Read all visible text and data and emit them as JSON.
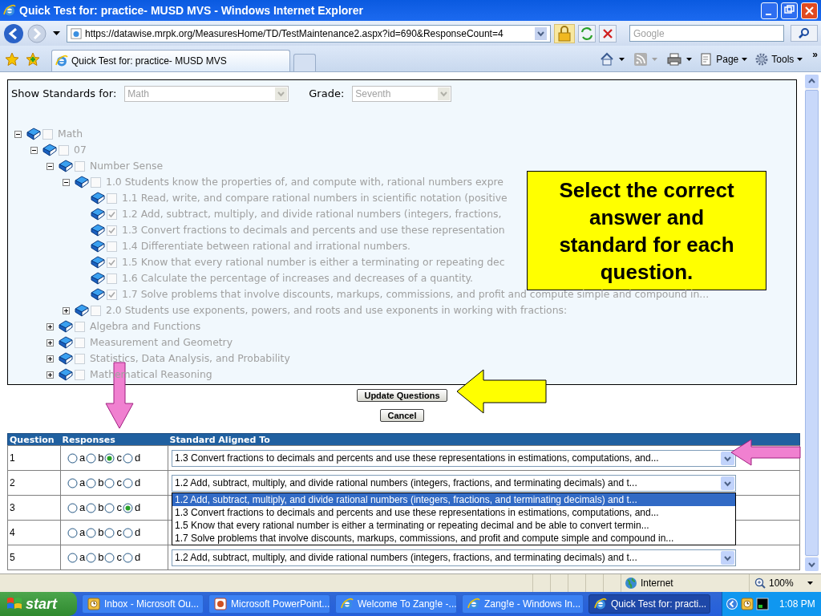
{
  "window": {
    "title": "Quick Test for: practice- MUSD MVS - Windows Internet Explorer"
  },
  "address_bar": {
    "url": "https://datawise.mrpk.org/MeasuresHome/TD/TestMaintenance2.aspx?id=690&ResponseCount=4",
    "search_placeholder": "Google"
  },
  "tabs": [
    {
      "label": "Quick Test for: practice- MUSD MVS",
      "selected": true
    }
  ],
  "command_bar": [
    "Page",
    "Tools",
    "»"
  ],
  "filters": [
    {
      "label": "Show Standards for:",
      "value": "Math"
    },
    {
      "label": "Grade:",
      "value": "Seventh"
    }
  ],
  "tree": [
    {
      "label": "Math",
      "checked": false,
      "expanded": true,
      "children": [
        {
          "label": "07",
          "checked": false,
          "expanded": true,
          "children": [
            {
              "label": "Number Sense",
              "checked": false,
              "expanded": true,
              "children": [
                {
                  "label": "1.0 Students know the properties of, and compute with, rational numbers expre",
                  "checked": false,
                  "expanded": true,
                  "children": [
                    {
                      "label": "1.1 Read, write, and compare rational numbers in scientific notation (positive",
                      "checked": false
                    },
                    {
                      "label": "1.2 Add, subtract, multiply, and divide rational numbers (integers, fractions,",
                      "checked": true
                    },
                    {
                      "label": "1.3 Convert fractions to decimals and percents and use these representation",
                      "checked": true
                    },
                    {
                      "label": "1.4 Differentiate between rational and irrational numbers.",
                      "checked": false
                    },
                    {
                      "label": "1.5 Know that every rational number is either a terminating or repeating dec",
                      "checked": true
                    },
                    {
                      "label": "1.6 Calculate the percentage of increases and decreases of a quantity.",
                      "checked": false
                    },
                    {
                      "label": "1.7 Solve problems that involve discounts, markups, commissions, and profit and compute simple and compound in...",
                      "checked": true
                    }
                  ]
                },
                {
                  "label": "2.0 Students use exponents, powers, and roots and use exponents in working with fractions:",
                  "checked": false,
                  "expanded": false
                }
              ]
            },
            {
              "label": "Algebra and Functions",
              "checked": false,
              "expanded": false
            },
            {
              "label": "Measurement and Geometry",
              "checked": false,
              "expanded": false
            },
            {
              "label": "Statistics, Data Analysis, and Probability",
              "checked": false,
              "expanded": false
            },
            {
              "label": "Mathematical Reasoning",
              "checked": false,
              "expanded": false
            }
          ]
        }
      ]
    }
  ],
  "buttons": [
    "Update Questions",
    "Cancel"
  ],
  "callout": "Select the correct answer and standard for each question.",
  "table": {
    "columns": [
      "Question",
      "Responses",
      "Standard Aligned To"
    ],
    "rows": [
      {
        "question": "1",
        "responses": [
          {
            "label": "a",
            "selected": false
          },
          {
            "label": "b",
            "selected": false
          },
          {
            "label": "c",
            "selected": true
          },
          {
            "label": "d",
            "selected": false
          }
        ],
        "standard": "1.3 Convert fractions to decimals and percents and use these representations in estimations, computations, and..."
      },
      {
        "question": "2",
        "responses": [
          {
            "label": "a",
            "selected": false
          },
          {
            "label": "b",
            "selected": false
          },
          {
            "label": "c",
            "selected": false
          },
          {
            "label": "d",
            "selected": false
          }
        ],
        "standard": "1.2 Add, subtract, multiply, and divide rational numbers (integers, fractions, and terminating decimals) and t...",
        "options": [
          {
            "label": "1.2 Add, subtract, multiply, and divide rational numbers (integers, fractions, and terminating decimals) and t...",
            "selected": true
          },
          {
            "label": "1.3 Convert fractions to decimals and percents and use these representations in estimations, computations, and...",
            "selected": false
          },
          {
            "label": "1.5 Know that every rational number is either a terminating or repeating decimal and be able to convert termin...",
            "selected": false
          },
          {
            "label": "1.7 Solve problems that involve discounts, markups, commissions, and profit and compute simple and compound in...",
            "selected": false
          }
        ]
      },
      {
        "question": "3",
        "responses": [
          {
            "label": "a",
            "selected": false
          },
          {
            "label": "b",
            "selected": false
          },
          {
            "label": "c",
            "selected": false
          },
          {
            "label": "d",
            "selected": true
          }
        ]
      },
      {
        "question": "4",
        "responses": [
          {
            "label": "a",
            "selected": false
          },
          {
            "label": "b",
            "selected": false
          },
          {
            "label": "c",
            "selected": false
          },
          {
            "label": "d",
            "selected": false
          }
        ]
      },
      {
        "question": "5",
        "responses": [
          {
            "label": "a",
            "selected": false
          },
          {
            "label": "b",
            "selected": false
          },
          {
            "label": "c",
            "selected": false
          },
          {
            "label": "d",
            "selected": false
          }
        ],
        "standard": "1.2 Add, subtract, multiply, and divide rational numbers (integers, fractions, and terminating decimals) and t..."
      }
    ]
  },
  "status_bar": {
    "zone": "Internet",
    "zoom": "100%"
  },
  "taskbar": {
    "start": "start",
    "items": [
      {
        "label": "Inbox - Microsoft Ou...",
        "kind": "outlook",
        "selected": false
      },
      {
        "label": "Microsoft PowerPoint...",
        "kind": "powerpoint",
        "selected": false
      },
      {
        "label": "Welcome To Zang!e -...",
        "kind": "browser",
        "selected": false
      },
      {
        "label": "Zang!e - Windows In...",
        "kind": "browser",
        "selected": false
      },
      {
        "label": "Quick Test for: practi...",
        "kind": "browser",
        "selected": true
      }
    ],
    "clock": "1:08 PM"
  }
}
